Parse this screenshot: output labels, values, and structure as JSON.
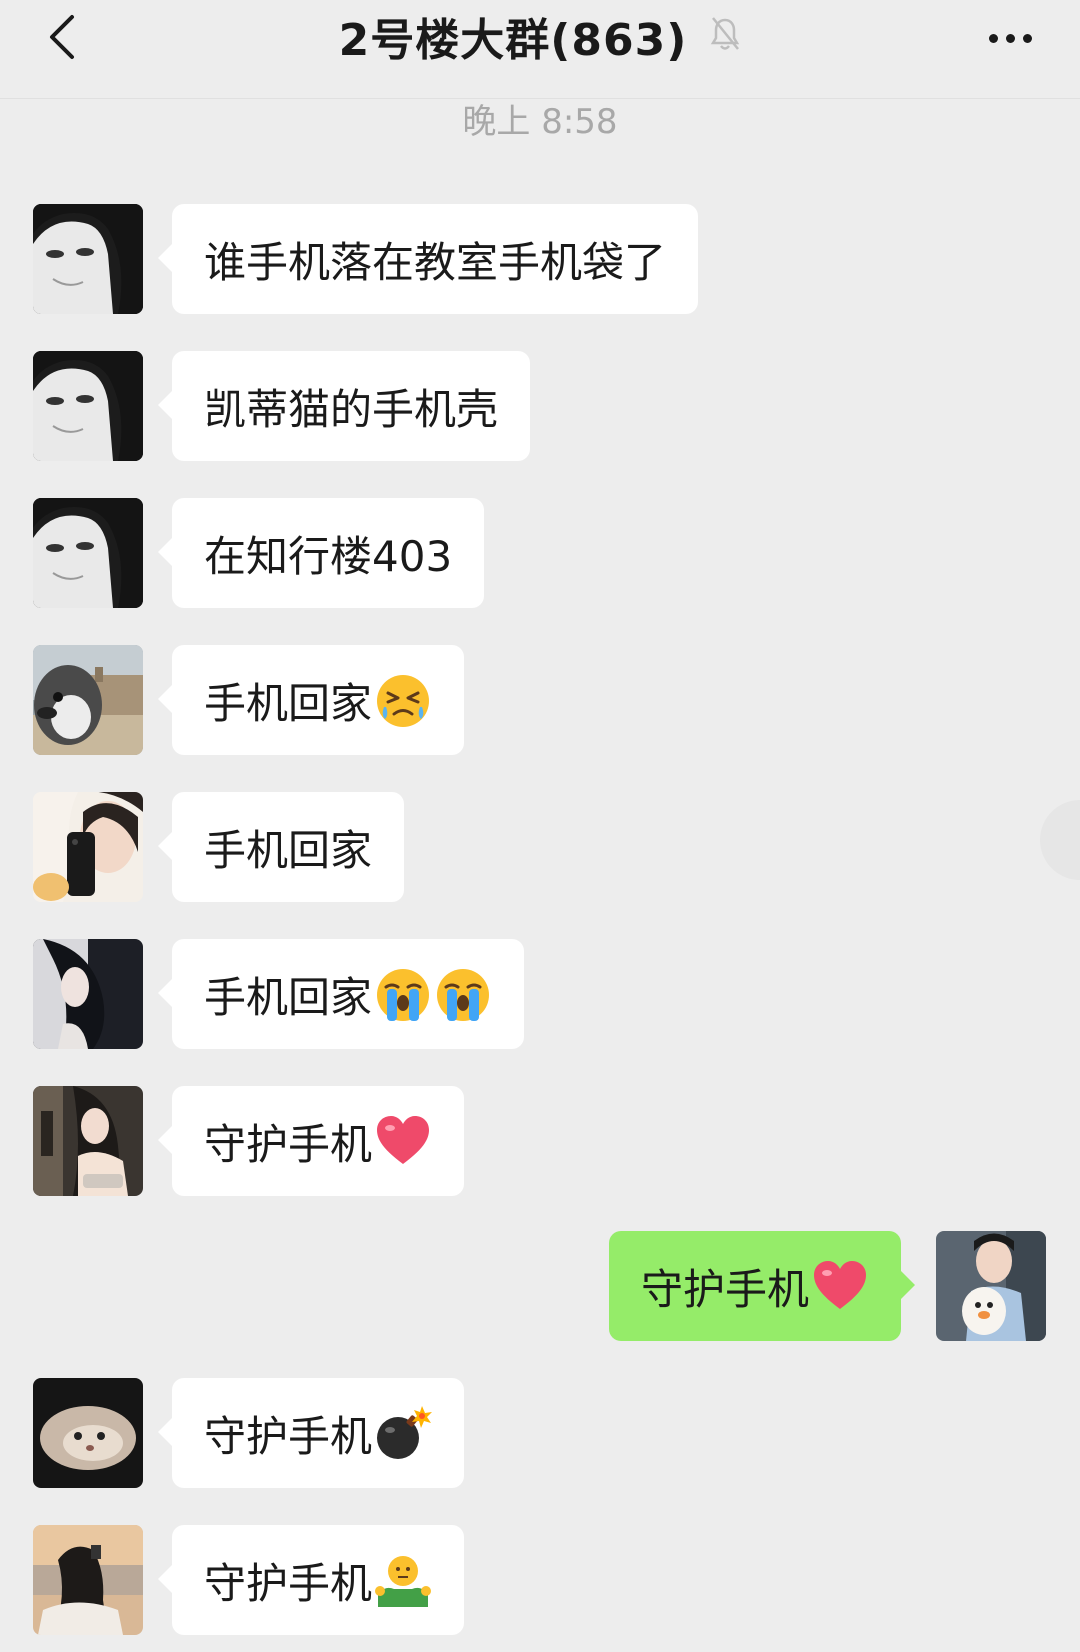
{
  "header": {
    "title": "2号楼大群(863)",
    "back_icon": "chevron-left-icon",
    "mute_icon": "bell-slash-icon",
    "more_icon": "ellipsis-icon"
  },
  "timestamp": "晚上 8:58",
  "messages": [
    {
      "side": "left",
      "avatar": "avatar-girl-bw",
      "text": "谁手机落在教室手机袋了",
      "emoji": []
    },
    {
      "side": "left",
      "avatar": "avatar-girl-bw",
      "text": "凯蒂猫的手机壳",
      "emoji": []
    },
    {
      "side": "left",
      "avatar": "avatar-girl-bw",
      "text": "在知行楼403",
      "emoji": []
    },
    {
      "side": "left",
      "avatar": "avatar-penguin",
      "text": "手机回家",
      "emoji": [
        "angry-tears-emoji"
      ]
    },
    {
      "side": "left",
      "avatar": "avatar-selfie-phone",
      "text": "手机回家",
      "emoji": []
    },
    {
      "side": "left",
      "avatar": "avatar-girl-dark",
      "text": "手机回家",
      "emoji": [
        "loudly-crying-emoji",
        "loudly-crying-emoji"
      ]
    },
    {
      "side": "left",
      "avatar": "avatar-girl-room",
      "text": "守护手机",
      "emoji": [
        "red-heart-emoji"
      ]
    },
    {
      "side": "right",
      "avatar": "avatar-me-dog",
      "text": "守护手机",
      "emoji": [
        "red-heart-emoji"
      ]
    },
    {
      "side": "left",
      "avatar": "avatar-cat",
      "text": "守护手机",
      "emoji": [
        "bomb-emoji"
      ]
    },
    {
      "side": "left",
      "avatar": "avatar-beach-girl",
      "text": "守护手机",
      "emoji": [
        "shrugging-emoji"
      ]
    }
  ],
  "colors": {
    "background": "#ededed",
    "bubble_left": "#ffffff",
    "bubble_right": "#95ec69",
    "timestamp": "#a8a8a8"
  }
}
